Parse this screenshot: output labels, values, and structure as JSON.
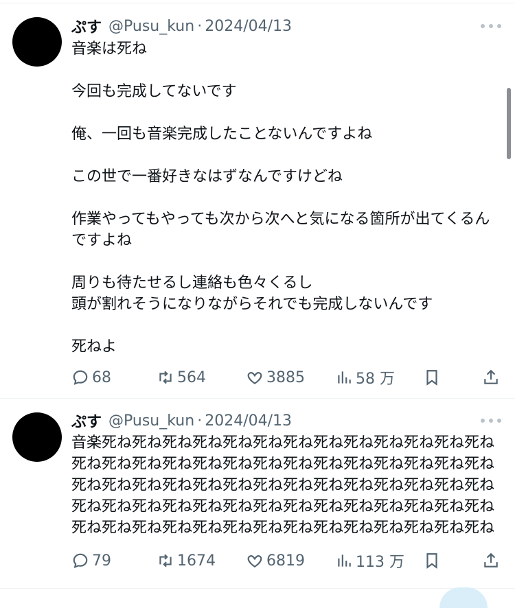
{
  "tweets": [
    {
      "name": "ぷす",
      "handle": "@Pusu_kun",
      "separator": "·",
      "date": "2024/04/13",
      "lines": [
        "音楽は死ね",
        "",
        "今回も完成してないです",
        "",
        "俺、一回も音楽完成したことないんですよね",
        "",
        "この世で一番好きなはずなんですけどね",
        "",
        "作業やってもやっても次から次へと気になる箇所が出てくるん",
        "ですよね",
        "",
        "周りも待たせるし連絡も色々くるし",
        "頭が割れそうになりながらそれでも完成しないんです",
        "",
        "死ねよ"
      ],
      "replies": "68",
      "retweets": "564",
      "likes": "3885",
      "views": "58 万"
    },
    {
      "name": "ぷす",
      "handle": "@Pusu_kun",
      "separator": "·",
      "date": "2024/04/13",
      "lines": [
        "音楽死ね死ね死ね死ね死ね死ね死ね死ね死ね死ね死ね死ね死ね",
        "死ね死ね死ね死ね死ね死ね死ね死ね死ね死ね死ね死ね死ね死ね",
        "死ね死ね死ね死ね死ね死ね死ね死ね死ね死ね死ね死ね死ね死ね",
        "死ね死ね死ね死ね死ね死ね死ね死ね死ね死ね死ね死ね死ね死ね",
        "死ね死ね死ね死ね死ね死ね死ね死ね死ね死ね死ね死ね死ね死ね"
      ],
      "replies": "79",
      "retweets": "1674",
      "likes": "6819",
      "views": "113 万"
    }
  ],
  "icons": {
    "reply": "reply-icon",
    "retweet": "retweet-icon",
    "like": "heart-icon",
    "views": "views-icon",
    "bookmark": "bookmark-icon",
    "share": "share-icon",
    "more": "more-icon"
  },
  "colors": {
    "text": "#0f1419",
    "secondary": "#536471",
    "divider": "#eff3f4"
  }
}
